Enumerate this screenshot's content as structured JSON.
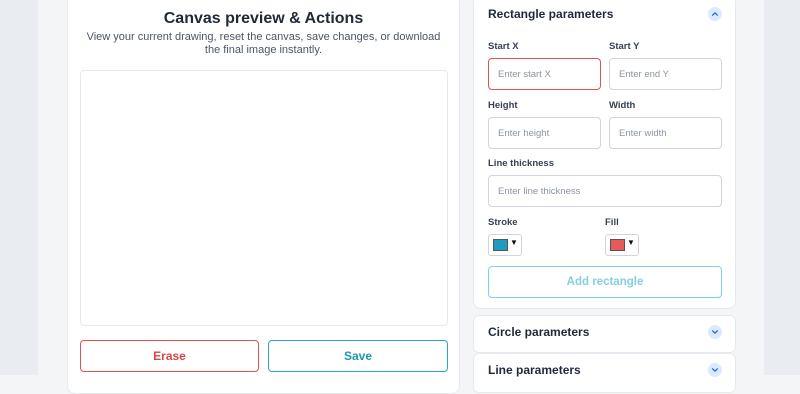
{
  "canvas": {
    "title": "Canvas preview & Actions",
    "subtitle": "View your current drawing, reset the canvas, save changes, or download the final image instantly.",
    "erase_label": "Erase",
    "save_label": "Save"
  },
  "rectangle": {
    "header": "Rectangle parameters",
    "expanded": true,
    "start_x": {
      "label": "Start X",
      "placeholder": "Enter start X",
      "value": ""
    },
    "start_y": {
      "label": "Start Y",
      "placeholder": "Enter end Y",
      "value": ""
    },
    "height": {
      "label": "Height",
      "placeholder": "Enter height",
      "value": ""
    },
    "width": {
      "label": "Width",
      "placeholder": "Enter width",
      "value": ""
    },
    "thickness": {
      "label": "Line thickness",
      "placeholder": "Enter line thickness",
      "value": ""
    },
    "stroke": {
      "label": "Stroke",
      "color": "#1e9bc0"
    },
    "fill": {
      "label": "Fill",
      "color": "#e85a5a"
    },
    "add_label": "Add rectangle"
  },
  "circle": {
    "header": "Circle parameters",
    "expanded": false
  },
  "line": {
    "header": "Line parameters",
    "expanded": false
  },
  "icons": {
    "collapse": "chevron-up-icon",
    "expand": "chevron-down-icon",
    "dropdown": "caret-down-icon"
  },
  "colors": {
    "accent": "#2aa6c4",
    "danger": "#e05252",
    "add_button_border": "#82d0e1"
  }
}
